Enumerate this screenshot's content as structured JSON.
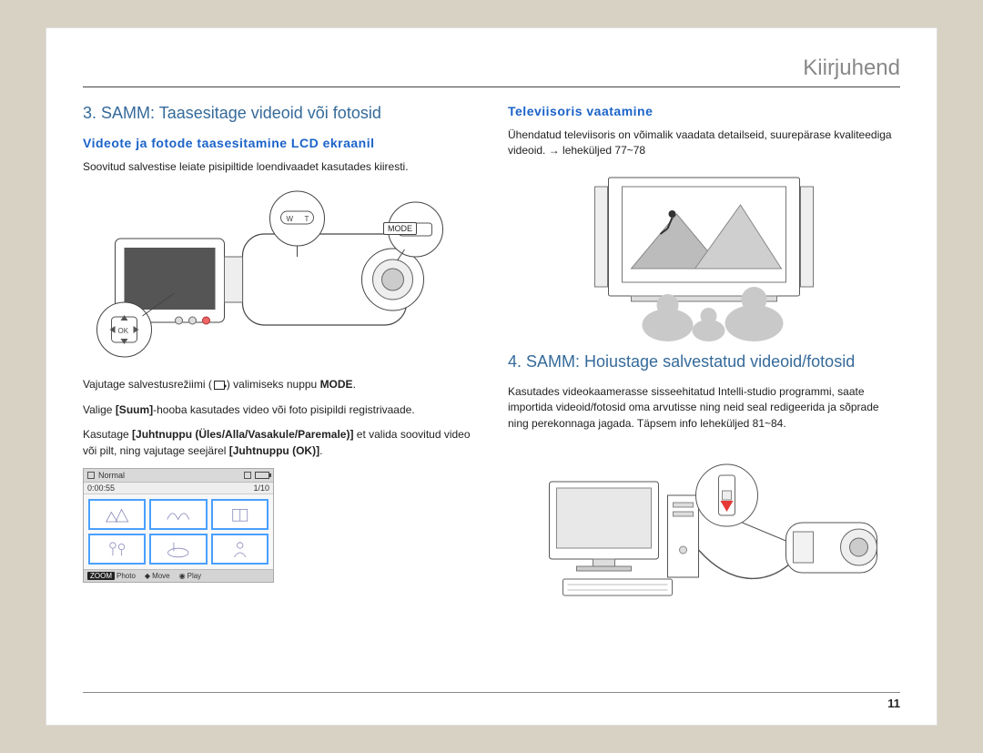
{
  "header": {
    "title": "Kiirjuhend"
  },
  "left": {
    "step_title": "3. SAMM: Taasesitage videoid või fotosid",
    "sub_title": "Videote ja fotode taasesitamine LCD ekraanil",
    "intro": "Soovitud salvestise leiate pisipiltide loendivaadet kasutades kiiresti.",
    "p1_pre": "Vajutage salvestusrežiimi (",
    "p1_post": ") valimiseks nuppu ",
    "p1_bold": "MODE",
    "p1_end": ".",
    "p2_pre": "Valige ",
    "p2_bold": "[Suum]",
    "p2_post": "-hooba kasutades video või foto pisipildi registrivaade.",
    "p3_pre": "Kasutage ",
    "p3_bold1": "[Juhtnuppu (Üles/Alla/Vasakule/Paremale)]",
    "p3_mid": " et valida soovitud video või pilt, ning vajutage seejärel ",
    "p3_bold2": "[Juhtnuppu (OK)]",
    "p3_end": ".",
    "thumb": {
      "mode": "Normal",
      "time": "0:00:55",
      "counter": "1/10",
      "footer_zoom": "ZOOM",
      "footer_photo": "Photo",
      "footer_move": "Move",
      "footer_play": "Play"
    },
    "mode_label": "MODE"
  },
  "right": {
    "sub_title": "Televiisoris vaatamine",
    "tv_text": "Ühendatud televiisoris on võimalik vaadata detailseid, suurepärase kvaliteediga videoid. → leheküljed 77~78",
    "step4_title": "4. SAMM: Hoiustage salvestatud videoid/fotosid",
    "step4_text": "Kasutades videokaamerasse sisseehitatud Intelli-studio programmi, saate importida videoid/fotosid oma arvutisse ning neid seal redigeerida ja sõprade ning perekonnaga jagada. Täpsem info leheküljed 81~84."
  },
  "page_number": "11"
}
